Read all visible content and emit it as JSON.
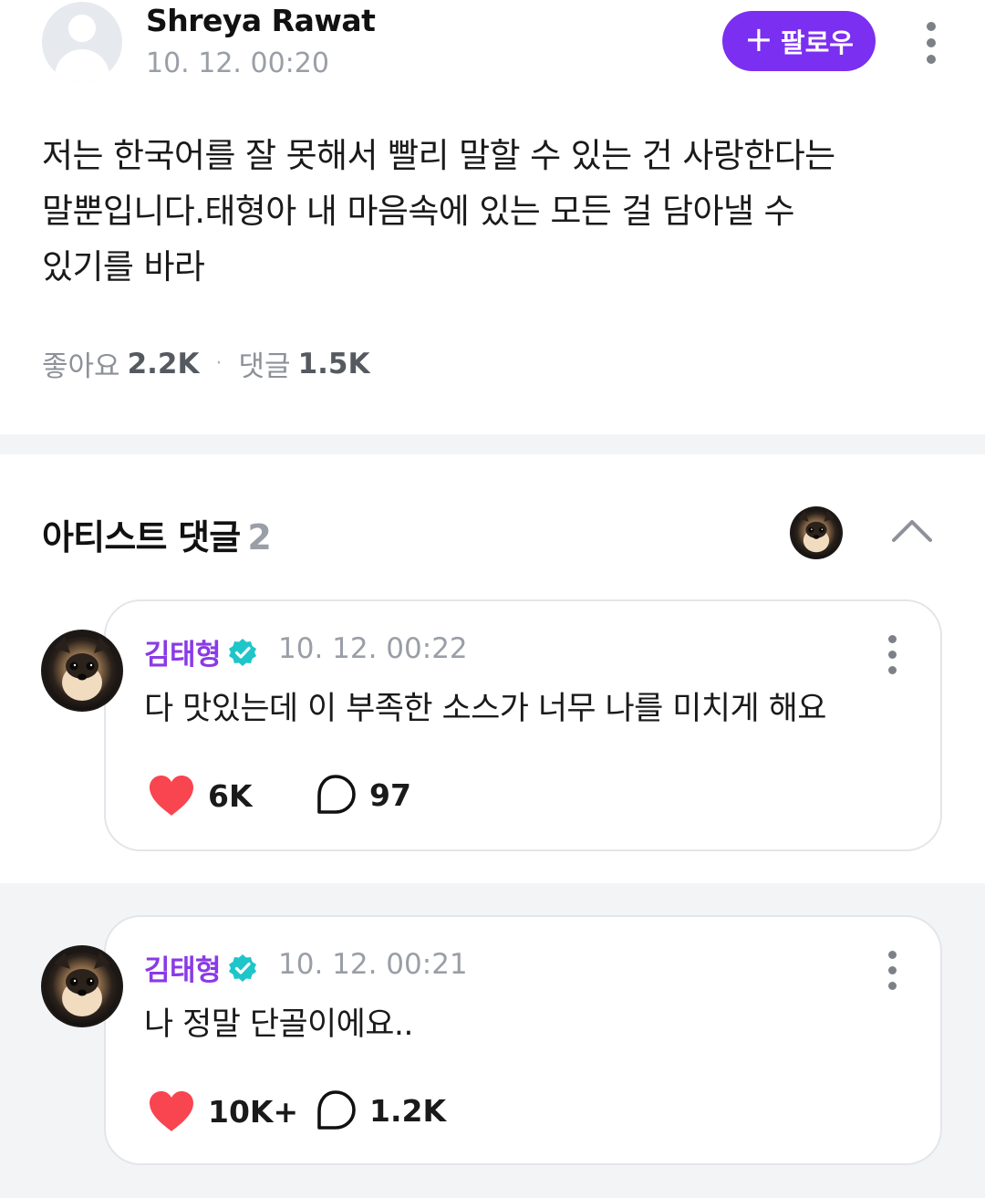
{
  "post": {
    "author": "Shreya Rawat",
    "timestamp": "10. 12. 00:20",
    "follow_label": "팔로우",
    "follow_icon": "plus-icon",
    "body_lines": [
      "저는 한국어를 잘 못해서 빨리 말할 수 있는 건 사랑한다는",
      "말뿐입니다.태형아 내 마음속에 있는 모든 걸 담아낼 수",
      "있기를 바라"
    ],
    "likes_label": "좋아요",
    "likes_count": "2.2K",
    "separator": "·",
    "comments_label": "댓글",
    "comments_count": "1.5K"
  },
  "artist_comments": {
    "title": "아티스트 댓글",
    "count": "2",
    "collapse_icon": "chevron-up-icon",
    "items": [
      {
        "name": "김태형",
        "timestamp": "10. 12. 00:22",
        "text": "다 맛있는데 이 부족한 소스가 너무 나를 미치게 해요",
        "likes": "6K",
        "replies": "97"
      },
      {
        "name": "김태형",
        "timestamp": "10. 12. 00:21",
        "text": "나 정말 단골이에요..",
        "likes": "10K+",
        "replies": "1.2K"
      }
    ]
  },
  "colors": {
    "accent": "#7b2ff0",
    "artist_name": "#8a3ae6",
    "verified_badge": "#1ec5c9",
    "heart": "#f8454f",
    "muted_text": "#9a9ea6",
    "band_background": "#f3f4f6"
  }
}
